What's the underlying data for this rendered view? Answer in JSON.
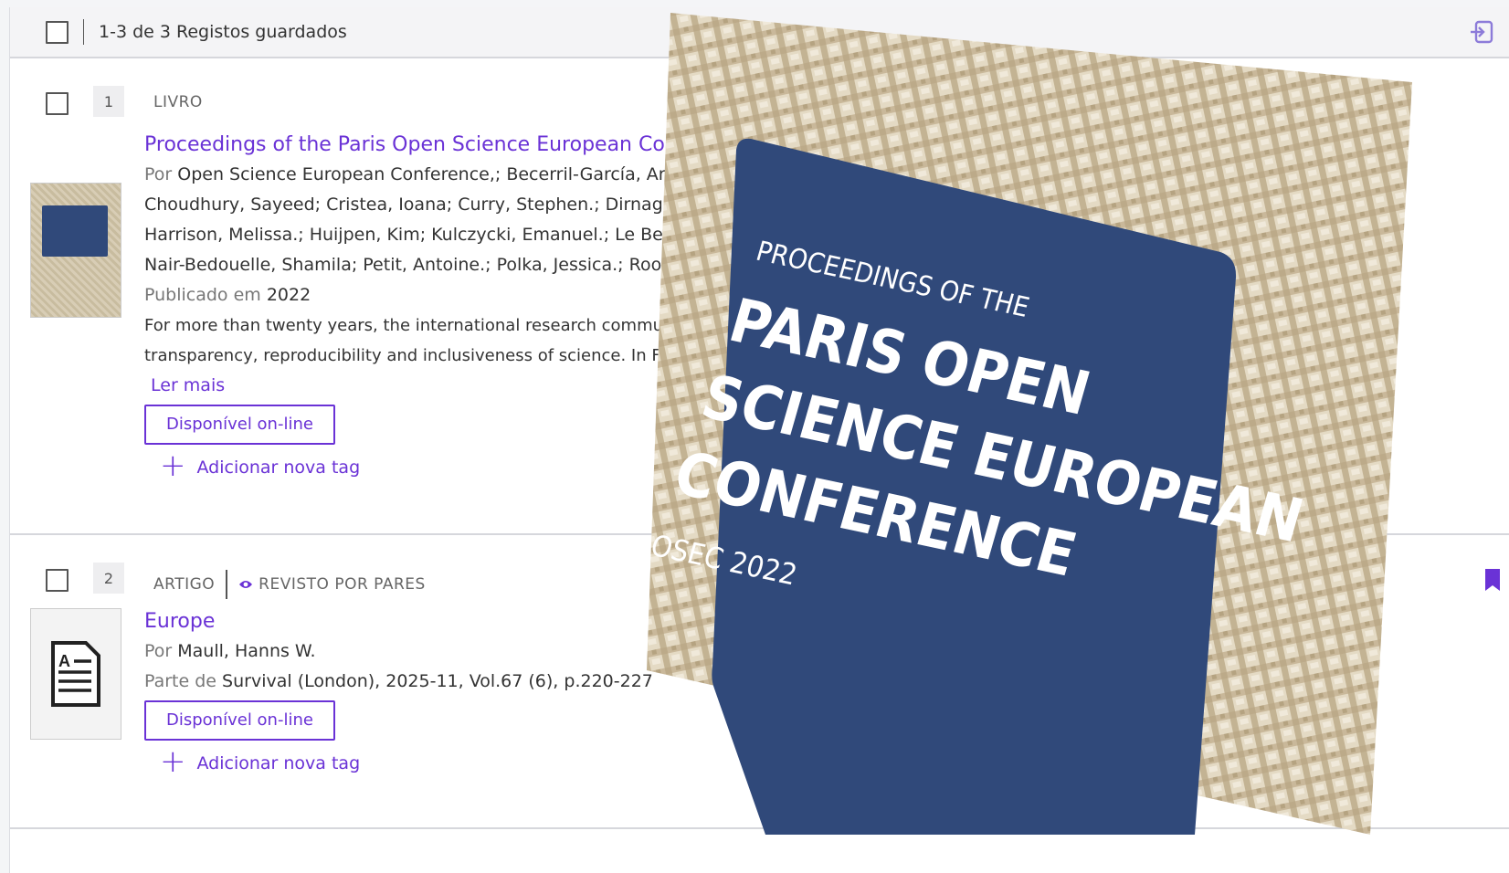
{
  "header": {
    "results_label": "1-3 de 3 Registos guardados"
  },
  "records": [
    {
      "number": "1",
      "type": "LIVRO",
      "title": "Proceedings of the Paris Open Science European Confe",
      "author_prefix": "Por",
      "author_lines": [
        "Open Science European Conference,; Becerril-García, Aria",
        "Choudhury, Sayeed; Cristea, Ioana; Curry, Stephen.; Dirnagl, U",
        "Harrison, Melissa.; Huijpen, Kim; Kulczycki, Emanuel.; Le Berr",
        "Nair-Bedouelle, Shamila; Petit, Antoine.; Polka, Jessica.; Roor"
      ],
      "published_prefix": "Publicado em",
      "published_year": "2022",
      "abstract_lines": [
        "For more than twenty years, the international research commu",
        "transparency, reproducibility and inclusiveness of science. In Fr"
      ],
      "read_more": "Ler mais",
      "available_label": "Disponível on-line",
      "add_tag_label": "Adicionar nova tag"
    },
    {
      "number": "2",
      "type": "ARTIGO",
      "peer_reviewed": "REVISTO POR PARES",
      "title": "Europe",
      "author_prefix": "Por",
      "author": "Maull, Hanns W.",
      "part_of_prefix": "Parte de",
      "part_of": "Survival (London), 2025-11, Vol.67 (6), p.220-227",
      "available_label": "Disponível on-line",
      "add_tag_label": "Adicionar nova tag"
    }
  ],
  "cover_overlay": {
    "line1": "PROCEEDINGS OF THE",
    "line2": "PARIS OPEN",
    "line3": "SCIENCE EUROPEAN",
    "line4": "CONFERENCE",
    "line5": "OSEC 2022"
  },
  "colors": {
    "accent": "#6a32d6",
    "cover_blue": "#30497a",
    "burlap": "#d3c6a8"
  }
}
